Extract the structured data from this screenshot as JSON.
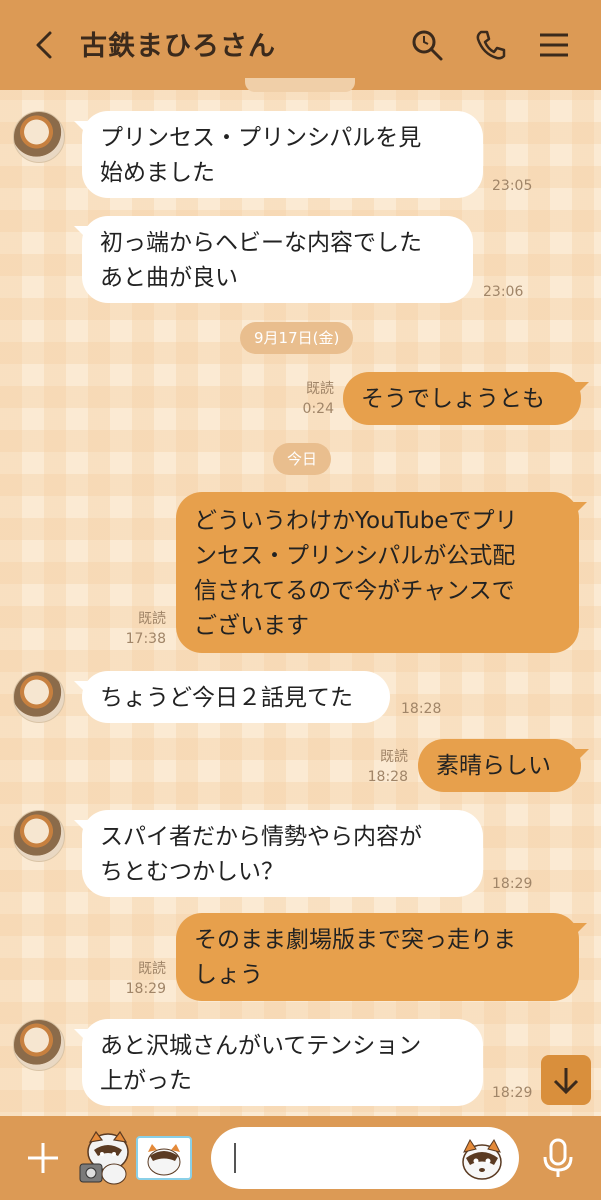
{
  "header": {
    "title": "古鉄まひろさん",
    "back_icon": "chevron-left-icon",
    "search_icon": "search-icon",
    "call_icon": "phone-icon",
    "menu_icon": "hamburger-menu-icon"
  },
  "messages": [
    {
      "side": "in",
      "lines": [
        "プリンセス・プリンシパルを見",
        "始めました"
      ],
      "time": "23:05"
    },
    {
      "side": "in",
      "lines": [
        "初っ端からヘビーな内容でした",
        "あと曲が良い"
      ],
      "time": "23:06"
    },
    {
      "side": "out",
      "lines": [
        "そうでしょうとも"
      ],
      "read": "既読",
      "time": "0:24"
    },
    {
      "side": "out",
      "lines": [
        "どういうわけかYouTubeでプリ",
        "ンセス・プリンシパルが公式配",
        "信されてるので今がチャンスで",
        "ございます"
      ],
      "read": "既読",
      "time": "17:38"
    },
    {
      "side": "in",
      "lines": [
        "ちょうど今日２話見てた"
      ],
      "time": "18:28"
    },
    {
      "side": "out",
      "lines": [
        "素晴らしい"
      ],
      "read": "既読",
      "time": "18:28"
    },
    {
      "side": "in",
      "lines": [
        "スパイ者だから情勢やら内容が",
        "ちとむつかしい？"
      ],
      "time": "18:29"
    },
    {
      "side": "out",
      "lines": [
        "そのまま劇場版まで突っ走りま",
        "しょう"
      ],
      "read": "既読",
      "time": "18:29"
    },
    {
      "side": "in",
      "lines": [
        "あと沢城さんがいてテンション",
        "上がった"
      ],
      "time": "18:29"
    }
  ],
  "dates": [
    "9月17日(金)",
    "今日"
  ],
  "footer": {
    "input_value": "",
    "plus_icon": "plus-icon",
    "mic_icon": "microphone-icon"
  },
  "colors": {
    "header": "#dc9a55",
    "outgoing_bubble": "#e7a04c",
    "incoming_bubble": "#ffffff",
    "background": "#fbead3"
  }
}
